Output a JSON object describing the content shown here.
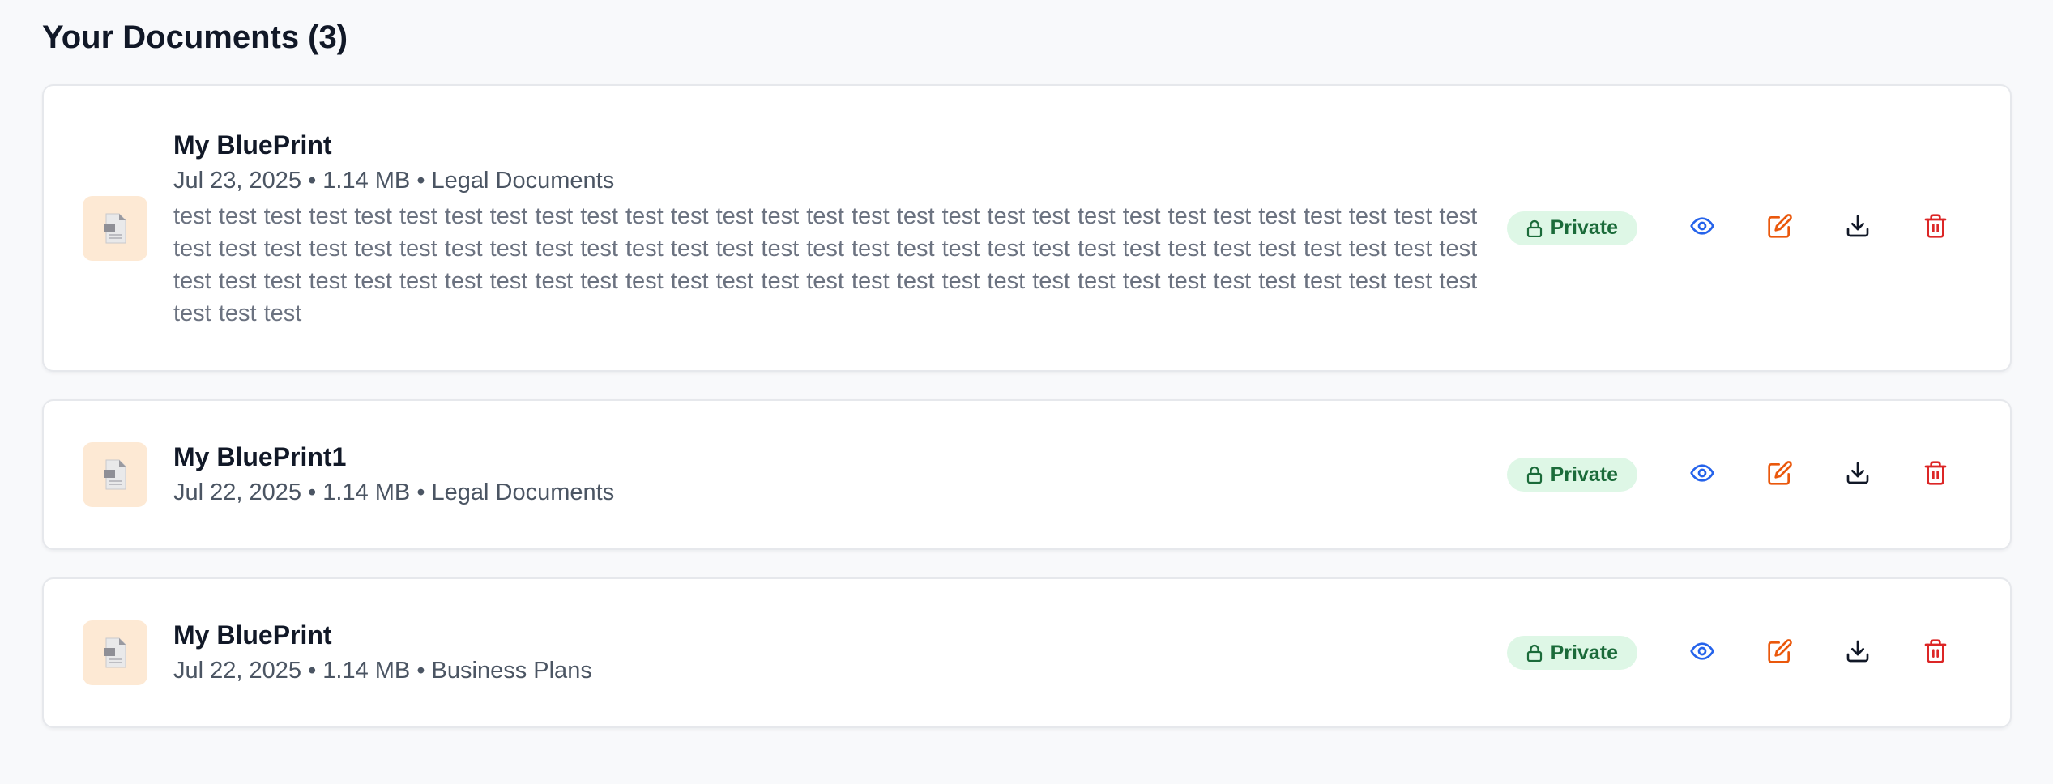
{
  "page": {
    "title": "Your Documents (3)"
  },
  "colors": {
    "view": "#2563eb",
    "edit": "#ea580c",
    "download": "#111827",
    "delete": "#dc2626",
    "badge_bg": "#def7e6",
    "badge_text": "#1b6b3a",
    "thumb_bg": "#fde9d4"
  },
  "icons": {
    "file": "file-document-icon",
    "lock": "lock-icon",
    "view": "eye-icon",
    "edit": "edit-icon",
    "download": "download-icon",
    "delete": "trash-icon"
  },
  "documents": [
    {
      "title": "My BluePrint",
      "date": "Jul 23, 2025",
      "size": "1.14 MB",
      "category": "Legal Documents",
      "meta": "Jul 23, 2025 • 1.14 MB • Legal Documents",
      "description": "test test test test test test test test test test test test test test test test test test test test test test test test test test test test test test test test test test test test test test test test test test test test test test test test test test test test test test test test test test test test test test test test test test test test test test test test test test test test test test test test test test test test test test test test test test",
      "visibility": "Private"
    },
    {
      "title": "My BluePrint1",
      "date": "Jul 22, 2025",
      "size": "1.14 MB",
      "category": "Legal Documents",
      "meta": "Jul 22, 2025 • 1.14 MB • Legal Documents",
      "visibility": "Private"
    },
    {
      "title": "My BluePrint",
      "date": "Jul 22, 2025",
      "size": "1.14 MB",
      "category": "Business Plans",
      "meta": "Jul 22, 2025 • 1.14 MB • Business Plans",
      "visibility": "Private"
    }
  ]
}
